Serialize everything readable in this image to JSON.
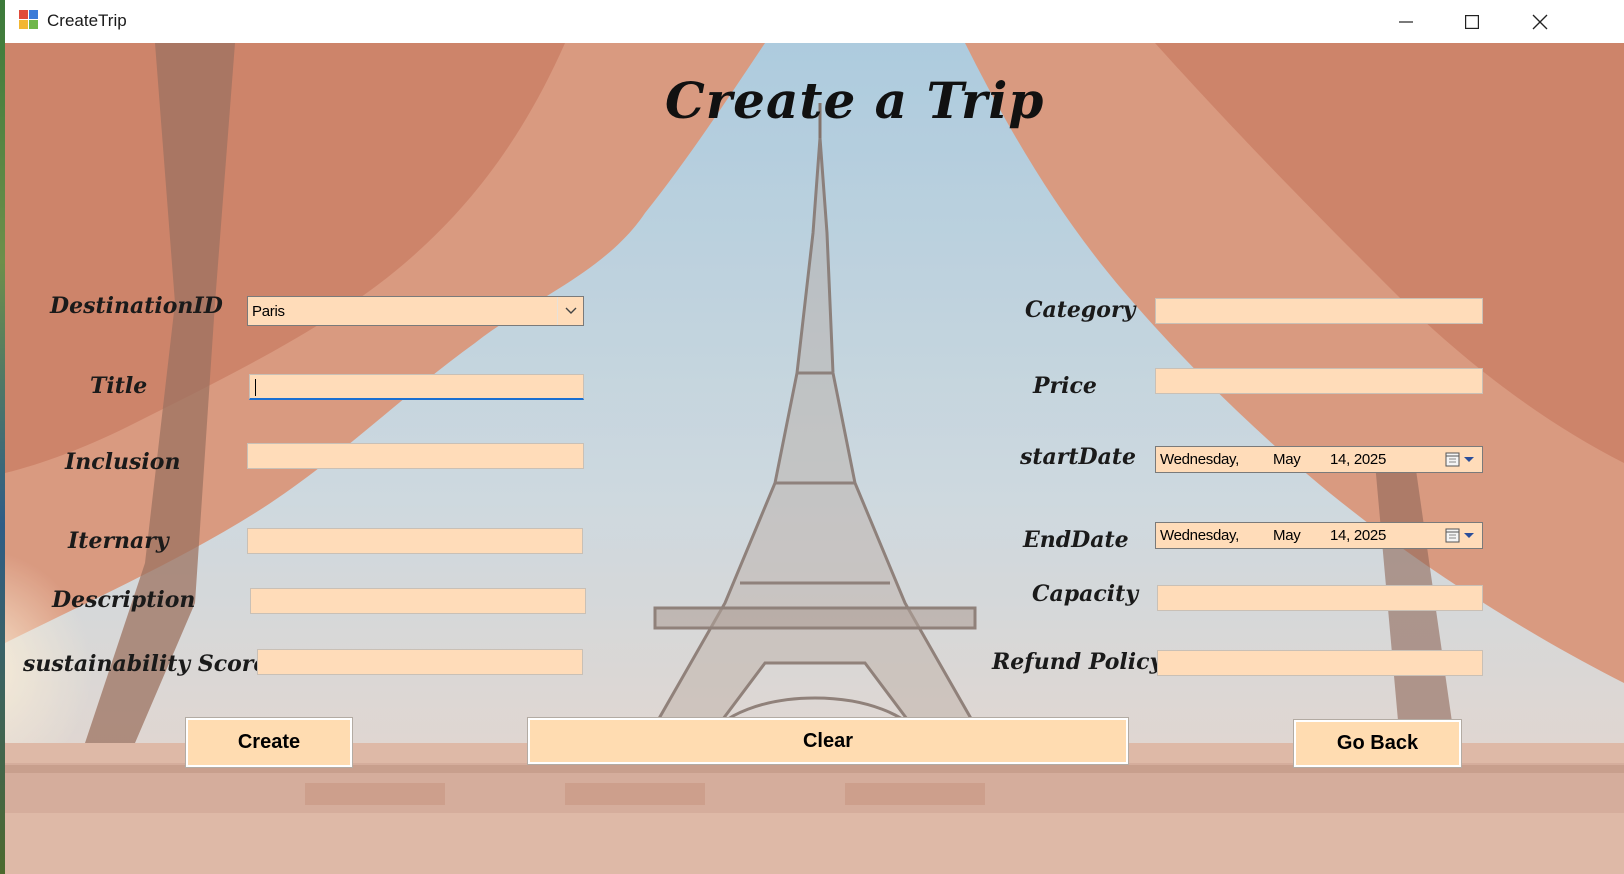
{
  "window": {
    "title": "CreateTrip"
  },
  "form": {
    "heading": "Create a Trip",
    "left": {
      "destination_label": "DestinationID",
      "destination_value": "Paris",
      "title_label": "Title",
      "title_value": "",
      "inclusion_label": "Inclusion",
      "inclusion_value": "",
      "itinerary_label": "Iternary",
      "itinerary_value": "",
      "description_label": "Description",
      "description_value": "",
      "sustainability_label": "sustainability Score",
      "sustainability_value": ""
    },
    "right": {
      "category_label": "Category",
      "category_value": "",
      "price_label": "Price",
      "price_value": "",
      "start_label": "startDate",
      "start_date": {
        "weekday": "Wednesday,",
        "month": "May",
        "day_year": "14, 2025"
      },
      "end_label": "EndDate",
      "end_date": {
        "weekday": "Wednesday,",
        "month": "May",
        "day_year": "14, 2025"
      },
      "capacity_label": "Capacity",
      "capacity_value": "",
      "refund_label": "Refund Policy",
      "refund_value": ""
    },
    "buttons": {
      "create": "Create",
      "clear": "Clear",
      "go_back": "Go Back"
    }
  },
  "colors": {
    "field_fill": "#ffdcb9",
    "button_fill": "#ffdcb1",
    "focus_accent": "#1a6fd1"
  },
  "icons": [
    "app-icon",
    "minimize-icon",
    "maximize-icon",
    "close-icon",
    "chevron-down-icon",
    "calendar-icon"
  ]
}
